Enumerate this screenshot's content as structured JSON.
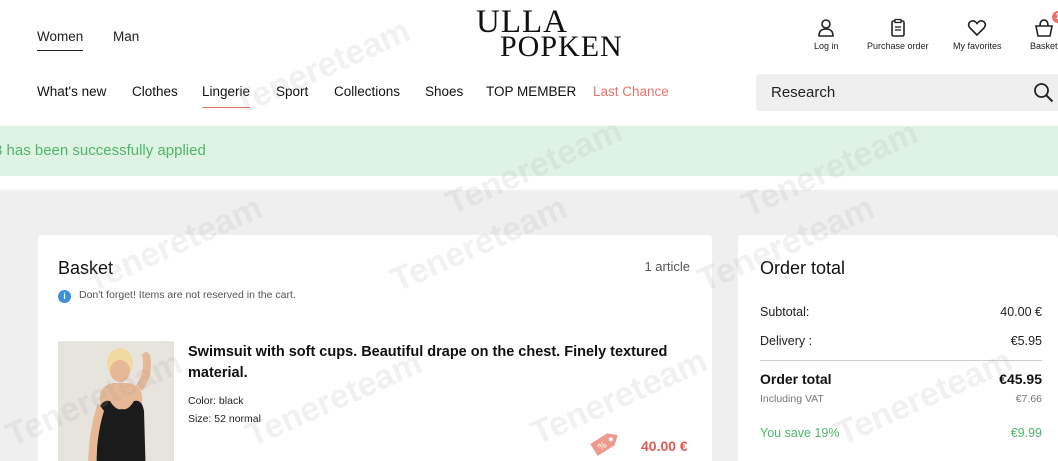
{
  "header": {
    "genders": [
      "Women",
      "Man"
    ],
    "logo": {
      "line1": "ULLA",
      "line2": "POPKEN"
    },
    "icons": [
      {
        "label": "Log in",
        "icon": "user-icon"
      },
      {
        "label": "Purchase order",
        "icon": "clipboard-icon"
      },
      {
        "label": "My favorites",
        "icon": "heart-icon"
      },
      {
        "label": "Basket",
        "icon": "basket-icon",
        "badge": "1"
      }
    ],
    "nav": [
      "What's new",
      "Clothes",
      "Lingerie",
      "Sport",
      "Collections",
      "Shoes",
      "TOP MEMBER",
      "Last Chance"
    ],
    "search_placeholder": "Research"
  },
  "banner": {
    "text": "3 has been successfully applied"
  },
  "basket": {
    "title": "Basket",
    "count": "1 article",
    "reminder": "Don't forget! Items are not reserved in the cart.",
    "item": {
      "title": "Swimsuit with soft cups. Beautiful drape on the chest. Finely textured material.",
      "color": "Color: black",
      "size": "Size: 52 normal",
      "price": "40.00 €",
      "tag": "%"
    }
  },
  "order": {
    "title": "Order total",
    "subtotal_label": "Subtotal:",
    "subtotal_value": "40.00 €",
    "delivery_label": "Delivery :",
    "delivery_value": "€5.95",
    "total_label": "Order total",
    "total_value": "€45.95",
    "vat_label": "Including VAT",
    "vat_value": "€7.66",
    "save_label": "You save 19%",
    "save_value": "€9.99"
  },
  "watermark": "Tenereteam",
  "colors": {
    "accent": "#e8736a",
    "success": "#4fb66c",
    "banner_bg": "#dff3e4"
  }
}
